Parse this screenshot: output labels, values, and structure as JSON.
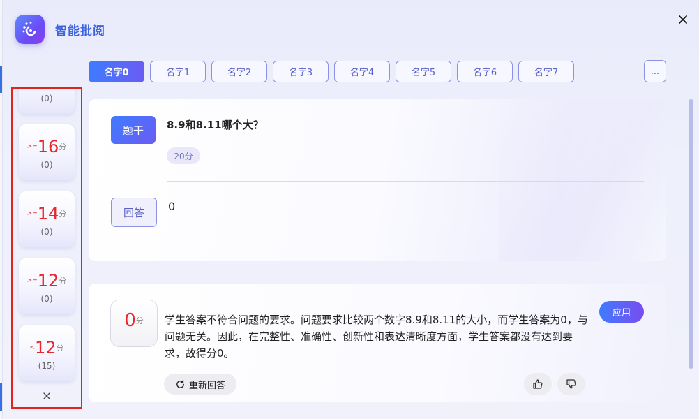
{
  "app": {
    "title": "智能批阅"
  },
  "tabs": [
    "名字0",
    "名字1",
    "名字2",
    "名字3",
    "名字4",
    "名字5",
    "名字6",
    "名字7"
  ],
  "active_tab": 0,
  "more_label": "...",
  "score_filters": [
    {
      "op": "",
      "num": "",
      "unit": "",
      "count": "(0)"
    },
    {
      "op": ">=",
      "num": "16",
      "unit": "分",
      "count": "(0)"
    },
    {
      "op": ">=",
      "num": "14",
      "unit": "分",
      "count": "(0)"
    },
    {
      "op": ">=",
      "num": "12",
      "unit": "分",
      "count": "(0)"
    },
    {
      "op": "<",
      "num": "12",
      "unit": "分",
      "count": "(15)"
    }
  ],
  "question": {
    "stem_label": "题干",
    "stem_text": "8.9和8.11哪个大？",
    "points": "20分",
    "answer_label": "回答",
    "answer_text": "0"
  },
  "result": {
    "score": "0",
    "score_unit": "分",
    "feedback": "学生答案不符合问题的要求。问题要求比较两个数字8.9和8.11的大小，而学生答案为0，与问题无关。因此，在完整性、准确性、创新性和表达清晰度方面，学生答案都没有达到要求，故得分0。",
    "apply_label": "应用",
    "reanswer_label": "重新回答"
  },
  "colors": {
    "accent": "#3f7bff",
    "accent2": "#6a5cf3",
    "score_red": "#e8262b",
    "highlight_border": "#e3231c"
  }
}
